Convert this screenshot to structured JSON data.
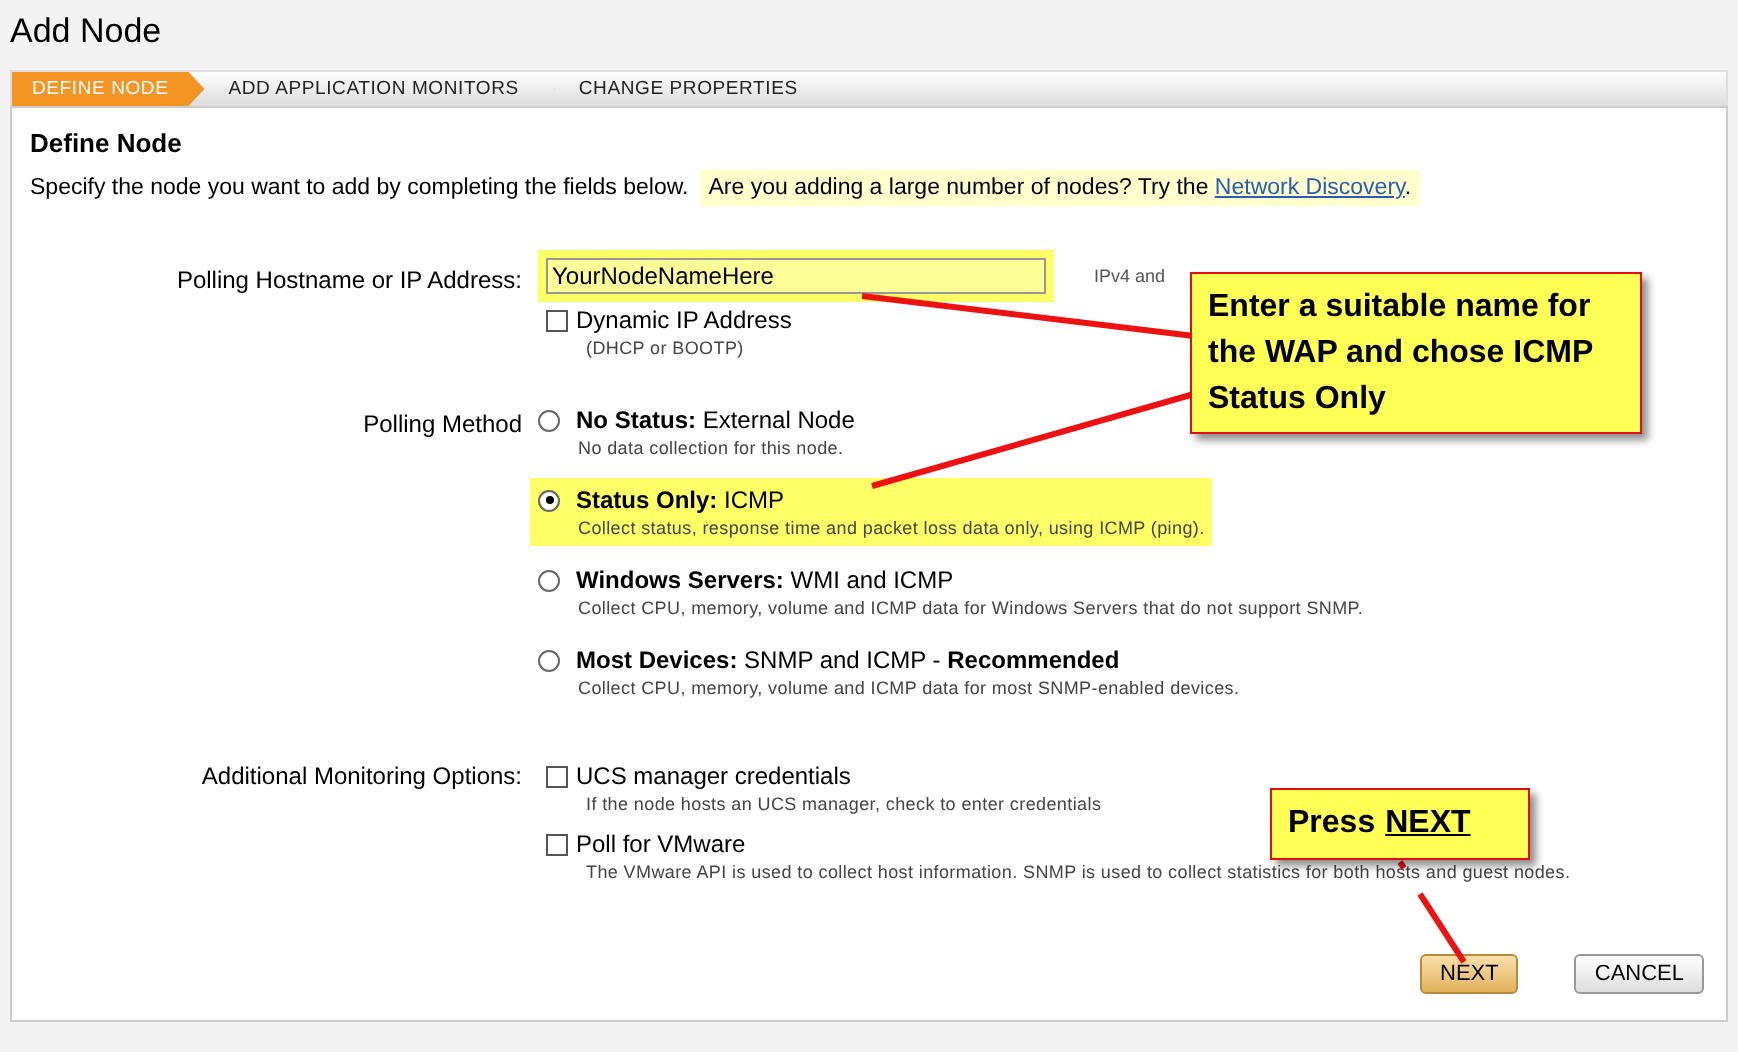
{
  "title": "Add Node",
  "steps": [
    {
      "label": "DEFINE NODE",
      "selected": true
    },
    {
      "label": "ADD APPLICATION MONITORS",
      "selected": false
    },
    {
      "label": "CHANGE PROPERTIES",
      "selected": false
    }
  ],
  "section": {
    "heading": "Define Node",
    "intro": "Specify the node you want to add by completing the fields below.",
    "tip": "Are you adding a large number of nodes? Try the",
    "tip_link": "Network Discovery",
    "tip_end": "."
  },
  "hostname": {
    "label": "Polling Hostname or IP Address:",
    "value": "YourNodeNameHere",
    "highlighted": true,
    "hint": "IPv4 and"
  },
  "dynamic_ip": {
    "label": "Dynamic IP Address",
    "note": "(DHCP or BOOTP)",
    "checked": false
  },
  "polling_method": {
    "label": "Polling Method",
    "options": [
      {
        "title": "**No Status:** External Node",
        "note": "No data collection for this node.",
        "selected": false,
        "highlighted": false
      },
      {
        "title": "**Status Only:** ICMP",
        "note": "Collect status, response time and packet loss data only, using ICMP (ping).",
        "selected": true,
        "highlighted": true
      },
      {
        "title": "**Windows Servers:** WMI and ICMP",
        "note": "Collect CPU, memory, volume and ICMP data for Windows Servers that do not support SNMP.",
        "selected": false,
        "highlighted": false
      },
      {
        "title": "**Most Devices:** SNMP and ICMP - **Recommended**",
        "note": "Collect CPU, memory, volume and ICMP data for most SNMP-enabled devices.",
        "selected": false,
        "highlighted": false
      }
    ]
  },
  "monitoring": {
    "label": "Additional Monitoring Options:",
    "options": [
      {
        "title": "UCS manager credentials",
        "note": "If the node hosts an UCS manager, check to enter credentials",
        "checked": false
      },
      {
        "title": "Poll for VMware",
        "note": "The VMware API is used to collect host information. SNMP is used to collect statistics for both hosts and guest nodes.",
        "checked": false
      }
    ]
  },
  "buttons": [
    {
      "label": "NEXT",
      "kind": "primary"
    },
    {
      "label": "CANCEL",
      "kind": "secondary"
    }
  ],
  "callouts": [
    {
      "text": "Enter a suitable name for the WAP and chose ICMP Status Only"
    },
    {
      "text": "Press",
      "emphasis": "NEXT"
    }
  ]
}
